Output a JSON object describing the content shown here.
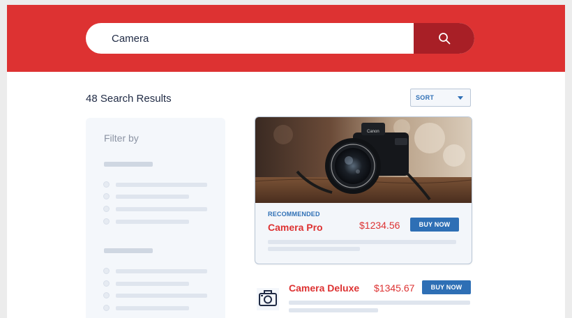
{
  "search": {
    "value": "Camera",
    "button_icon": "search-icon"
  },
  "results": {
    "count_label": "48 Search Results"
  },
  "sort": {
    "label": "SORT",
    "icon": "caret-down-icon"
  },
  "filter": {
    "title": "Filter by"
  },
  "products": [
    {
      "tag": "RECOMMENDED",
      "name": "Camera Pro",
      "price": "$1234.56",
      "button": "BUY NOW",
      "image": "camera-photo"
    },
    {
      "name": "Camera Deluxe",
      "price": "$1345.67",
      "button": "BUY NOW",
      "icon": "camera-icon"
    }
  ],
  "colors": {
    "brand_red": "#dd3232",
    "search_button": "#a81f26",
    "accent_blue": "#2e6fb5",
    "panel_bg": "#f4f7fb"
  }
}
